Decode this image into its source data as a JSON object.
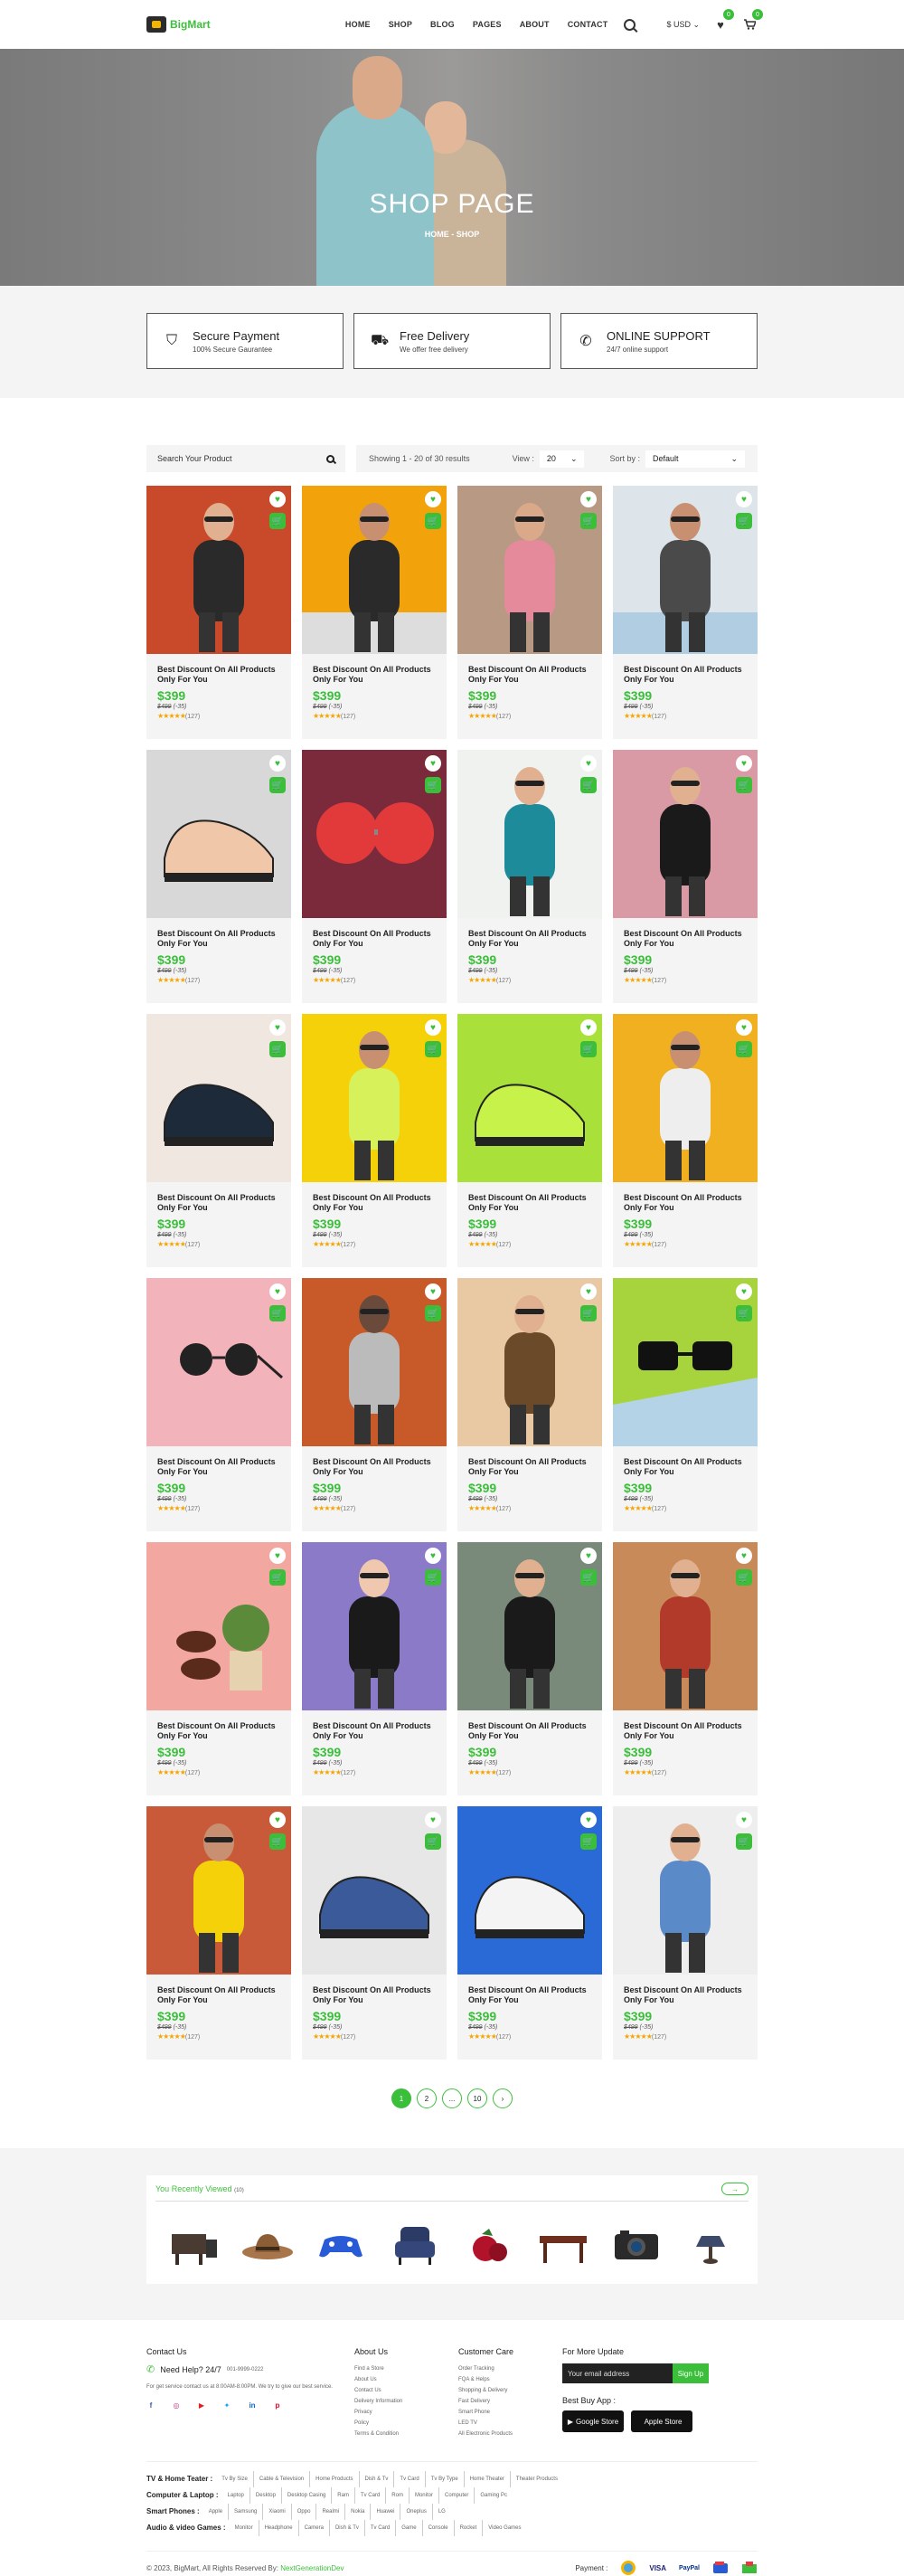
{
  "header": {
    "logo_text": "BigMart",
    "nav": [
      "HOME",
      "SHOP",
      "BLOG",
      "PAGES",
      "ABOUT",
      "CONTACT"
    ],
    "currency": "$ USD",
    "wishlist_count": "0",
    "cart_count": "0"
  },
  "hero": {
    "title": "SHOP PAGE",
    "breadcrumb": "HOME - SHOP"
  },
  "features": [
    {
      "title": "Secure Payment",
      "subtitle": "100% Secure Gaurantee",
      "icon": "shield-icon"
    },
    {
      "title": "Free Delivery",
      "subtitle": "We offer free delivery",
      "icon": "truck-icon"
    },
    {
      "title": "ONLINE SUPPORT",
      "subtitle": "24/7 online support",
      "icon": "phone-icon"
    }
  ],
  "toolbar": {
    "search_placeholder": "Search Your Product",
    "results": "Showing 1 - 20 of 30 results",
    "view_label": "View :",
    "view_value": "20",
    "sort_label": "Sort by :",
    "sort_value": "Default"
  },
  "product_common": {
    "name": "Best Discount On All Products Only For You",
    "price": "$399",
    "old_price": "$499",
    "discount": "(-35)",
    "stars": "★★★★★",
    "reviews": "(127)"
  },
  "pagination": [
    "1",
    "2",
    "...",
    "10",
    "›"
  ],
  "recent": {
    "title": "You Recently Viewed",
    "count": "(10)",
    "arrow": "→"
  },
  "footer": {
    "contact_title": "Contact Us",
    "need_help": "Need Help? 24/7",
    "phone": "001-9999-0222",
    "contact_text": "For get service contact us at 8:00AM-8:00PM. We try to give our best service.",
    "about_title": "About Us",
    "about_links": [
      "Find a Store",
      "About Us",
      "Contact Us",
      "Delivery Information",
      "Privacy",
      "Policy",
      "Terms & Condition"
    ],
    "care_title": "Customer Care",
    "care_links": [
      "Order Tracking",
      "FQA & Helps",
      "Shopping & Delivery",
      "Fast Delivery",
      "Smart Phone",
      "LED TV",
      "All Electronic Products"
    ],
    "update_title": "For More Update",
    "email_placeholder": "Your email address",
    "signup": "Sign Up",
    "best_buy": "Best Buy App :",
    "google": "Google Store",
    "apple": "Apple Store"
  },
  "categories": [
    {
      "label": "TV & Home Teater :",
      "items": [
        "Tv By Size",
        "Cable & Television",
        "Home Products",
        "Dish & Tv",
        "Tv Card",
        "Tv By Type",
        "Home Theater",
        "Theater Products"
      ]
    },
    {
      "label": "Computer & Laptop :",
      "items": [
        "Laptop",
        "Desktop",
        "Desktop Casing",
        "Ram",
        "Tv Card",
        "Rom",
        "Monitor",
        "Computer",
        "Gaming Pc"
      ]
    },
    {
      "label": "Smart Phones :",
      "items": [
        "Apple",
        "Samsung",
        "Xiaomi",
        "Oppo",
        "Realmi",
        "Nokia",
        "Huawei",
        "Oneplus",
        "LG"
      ]
    },
    {
      "label": "Audio & video Games :",
      "items": [
        "Monitor",
        "Headphone",
        "Camera",
        "Dish & Tv",
        "Tv Card",
        "Game",
        "Console",
        "Rocket",
        "Video Games"
      ]
    }
  ],
  "bottom": {
    "copyright": "© 2023, BigMart, All Rights Reserved By:",
    "author": "NextGenerationDev",
    "payment_label": "Payment :",
    "visa": "VISA",
    "paypal": "PayPal"
  },
  "colors": {
    "accent": "#3bbf3b",
    "dark": "#222222",
    "panel": "#f4f4f4"
  }
}
